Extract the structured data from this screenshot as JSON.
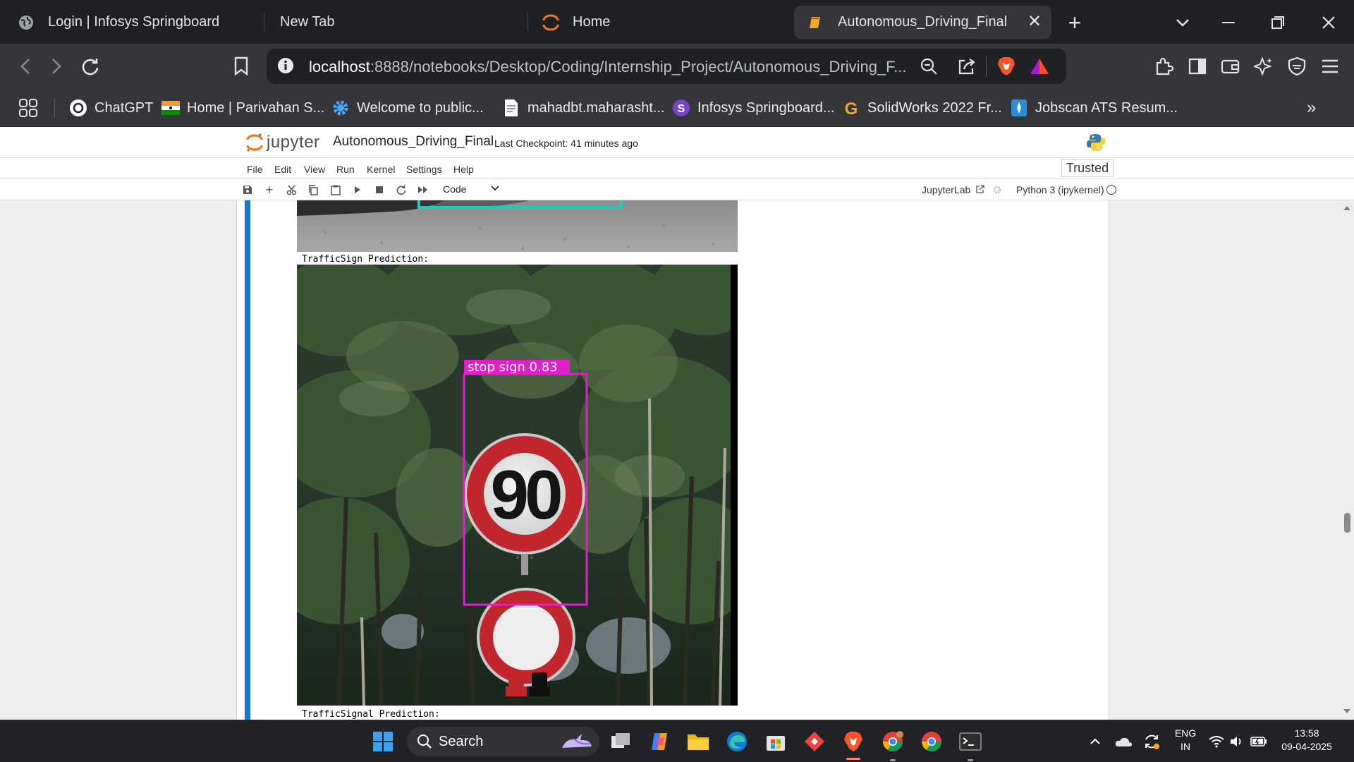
{
  "browser": {
    "tabs": [
      {
        "label": "Login | Infosys Springboard",
        "active": false
      },
      {
        "label": "New Tab",
        "active": false
      },
      {
        "label": "Home",
        "active": false
      },
      {
        "label": "Autonomous_Driving_Final",
        "active": true
      }
    ],
    "url": {
      "host": "localhost",
      "path": ":8888/notebooks/Desktop/Coding/Internship_Project/Autonomous_Driving_F..."
    },
    "bookmarks": [
      {
        "label": "ChatGPT"
      },
      {
        "label": "Home | Parivahan S..."
      },
      {
        "label": "Welcome to public..."
      },
      {
        "label": "mahadbt.maharasht..."
      },
      {
        "label": "Infosys Springboard..."
      },
      {
        "label": "SolidWorks 2022 Fr..."
      },
      {
        "label": "Jobscan ATS Resum..."
      }
    ]
  },
  "jupyter": {
    "logo_text": "jupyter",
    "notebook_title": "Autonomous_Driving_Final",
    "checkpoint": "Last Checkpoint: 41 minutes ago",
    "menu": [
      "File",
      "Edit",
      "View",
      "Run",
      "Kernel",
      "Settings",
      "Help"
    ],
    "trusted": "Trusted",
    "cell_type": "Code",
    "jupyterlab_link": "JupyterLab",
    "kernel": "Python 3 (ipykernel)",
    "outputs": {
      "traffic_sign_label": "TrafficSign Prediction:",
      "detection_label": "stop sign  0.83",
      "sign_number": "90",
      "traffic_signal_label": "TrafficSignal Prediction:"
    }
  },
  "taskbar": {
    "search": "Search",
    "language": "ENG",
    "region": "IN",
    "time": "13:58",
    "date": "09-04-2025"
  },
  "colors": {
    "tab_strip": "#1f2023",
    "toolbar": "#35363a",
    "cell_accent": "#1976d2",
    "detection_box": "#e020c8",
    "taskbar": "#202226"
  }
}
